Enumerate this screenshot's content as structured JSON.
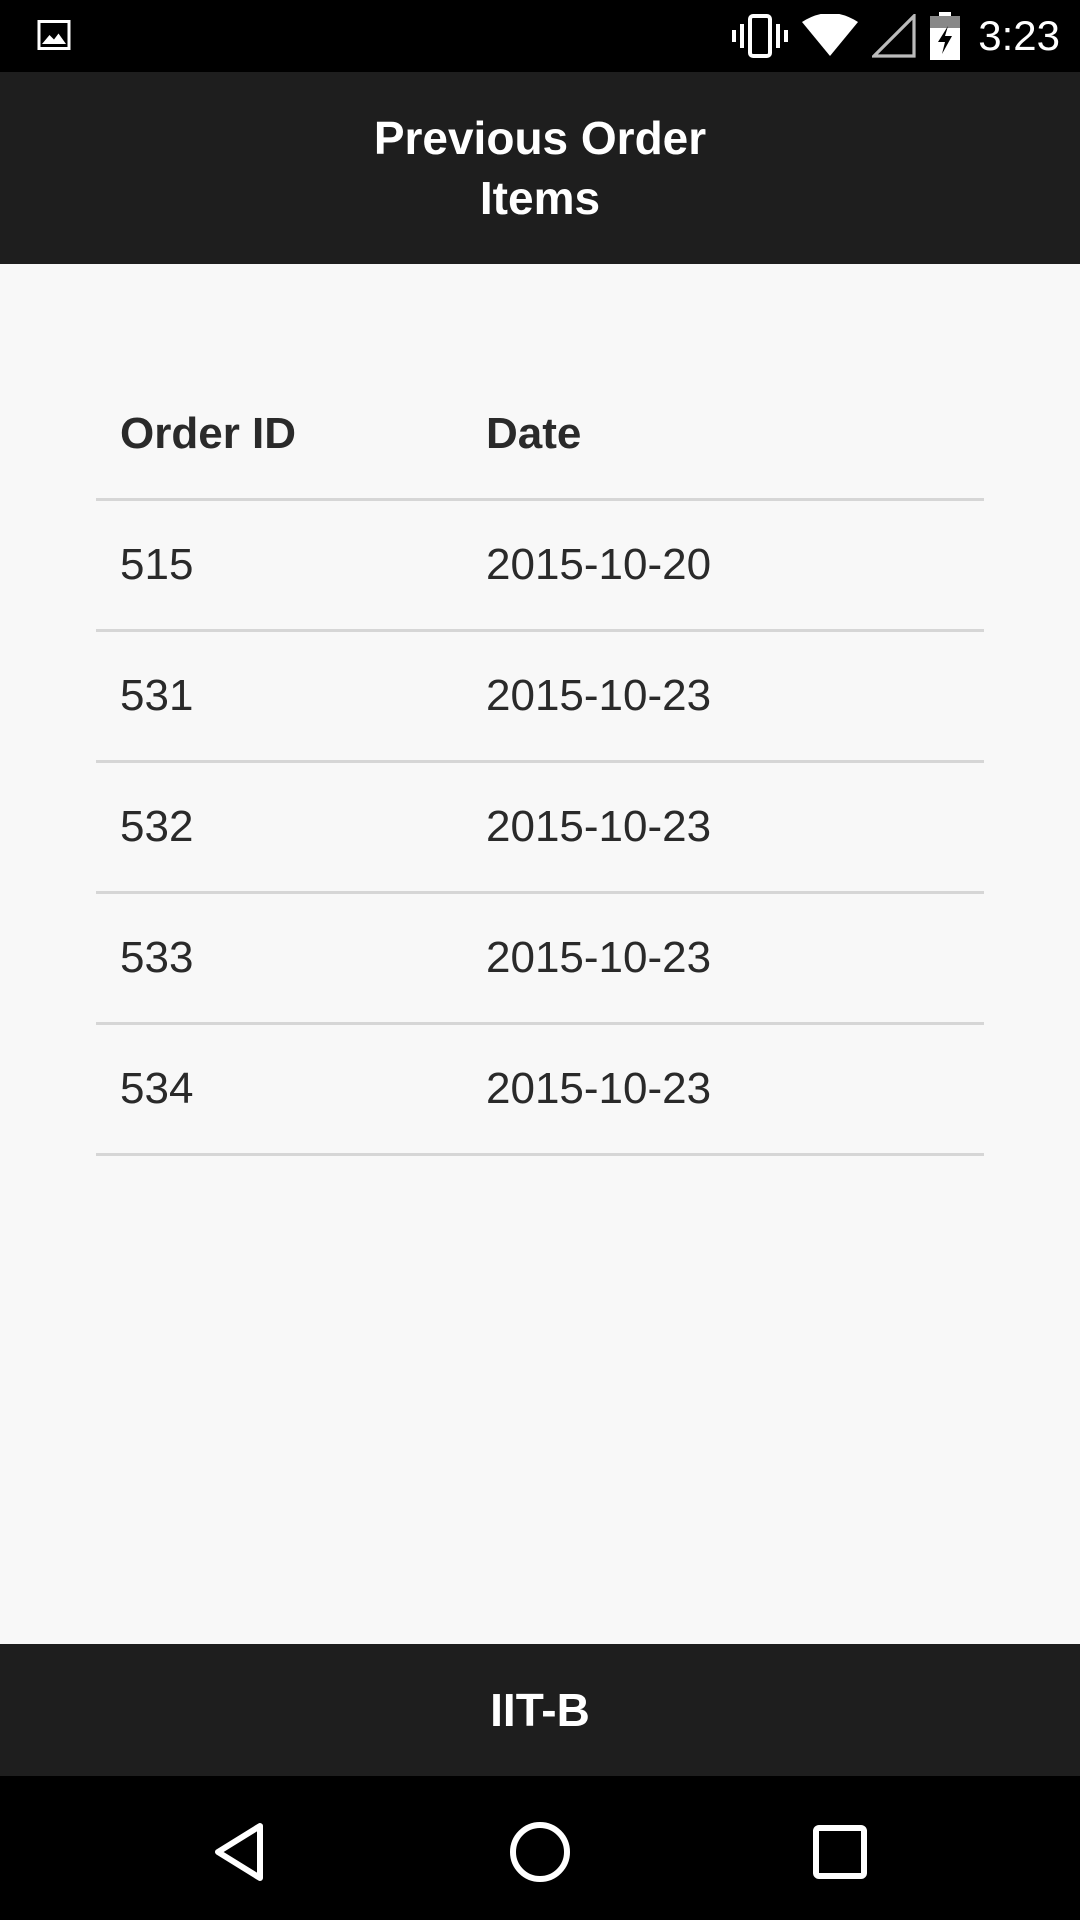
{
  "status_bar": {
    "time": "3:23",
    "icons": [
      "image-icon",
      "vibrate-icon",
      "wifi-icon",
      "cell-signal-icon",
      "battery-charging-icon"
    ]
  },
  "app_bar": {
    "title": "Previous Order Items"
  },
  "table": {
    "headers": [
      "Order ID",
      "Date"
    ],
    "rows": [
      [
        "515",
        "2015-10-20"
      ],
      [
        "531",
        "2015-10-23"
      ],
      [
        "532",
        "2015-10-23"
      ],
      [
        "533",
        "2015-10-23"
      ],
      [
        "534",
        "2015-10-23"
      ]
    ]
  },
  "footer": {
    "label": "IIT-B"
  },
  "nav": {
    "icons": [
      "back-icon",
      "home-icon",
      "recents-icon"
    ]
  },
  "colors": {
    "bar_background": "#1e1e1e",
    "page_background": "#f8f8f8",
    "divider": "#d6d6d6"
  }
}
